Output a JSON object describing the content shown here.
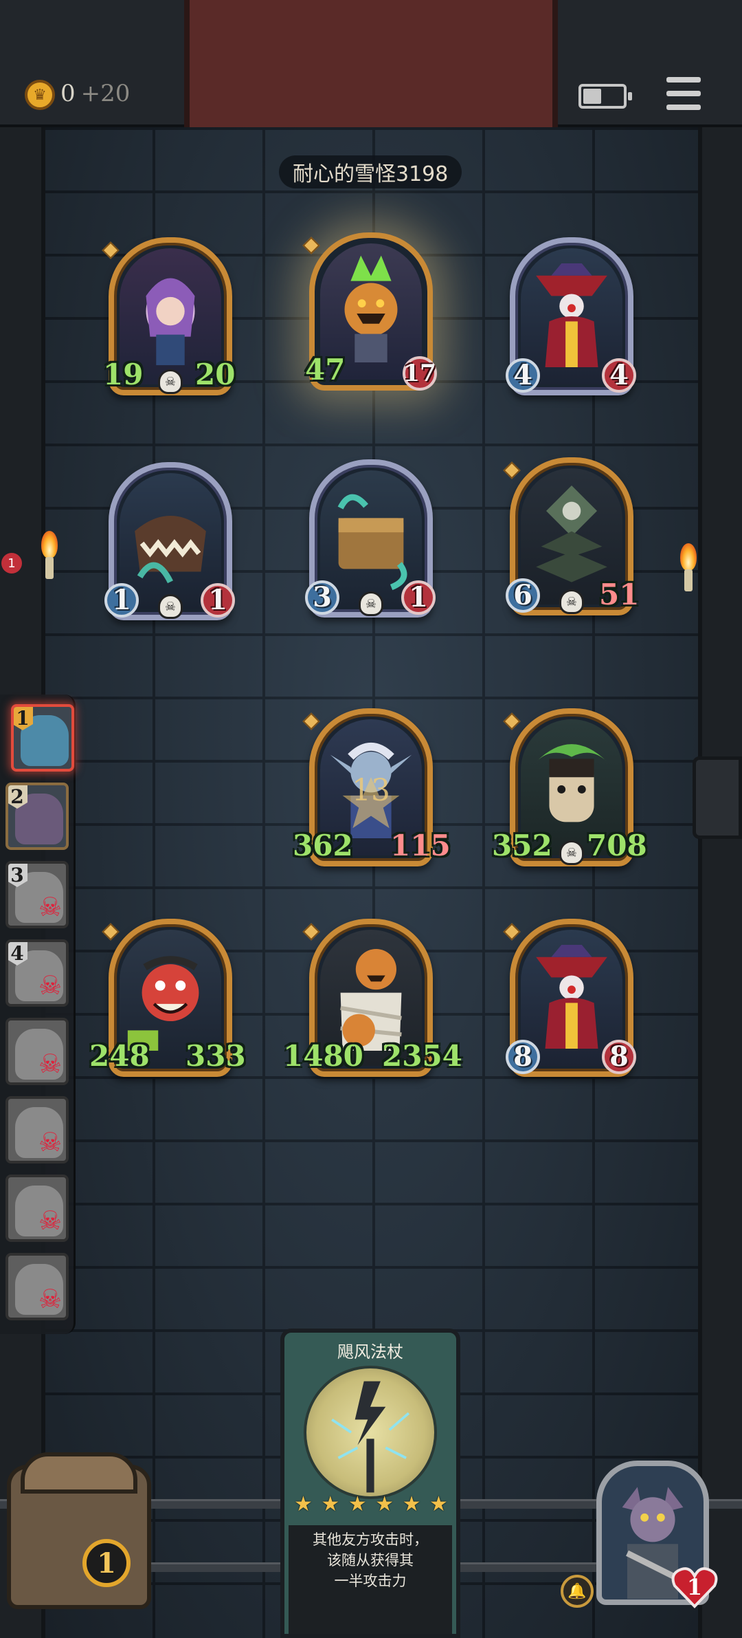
{
  "hud": {
    "gold": "0",
    "gold_income": "+20",
    "coin_icon": "crown-coin-icon",
    "battery_icon": "battery-icon",
    "menu_icon": "menu-icon"
  },
  "opponent_name": "耐心的雪怪3198",
  "board": [
    {
      "name": "witch-mage",
      "atk": "19",
      "hp": "20",
      "style": "plain",
      "tier_frame": "gold",
      "skull": true
    },
    {
      "name": "pumpkin-knight",
      "atk": "47",
      "hp": "17",
      "style": "atk-plain-hp-badge",
      "tier_frame": "gold",
      "skull": false
    },
    {
      "name": "clown",
      "atk": "4",
      "hp": "4",
      "style": "badge",
      "tier_frame": "silver",
      "skull": false
    },
    {
      "name": "mimic-teeth",
      "atk": "1",
      "hp": "1",
      "style": "badge",
      "tier_frame": "silver",
      "skull": true
    },
    {
      "name": "treasure-chest-mimic",
      "atk": "3",
      "hp": "1",
      "style": "badge",
      "tier_frame": "silver",
      "skull": true
    },
    {
      "name": "skull-pagoda",
      "atk": "6",
      "hp": "51",
      "style": "badge-hpred",
      "tier_frame": "gold",
      "skull": true
    },
    {
      "name": "dark-elf",
      "atk": "362",
      "hp": "115",
      "overlay": "13",
      "style": "plain-hpred",
      "tier_frame": "gold",
      "skull": false
    },
    {
      "name": "leaf-sprite",
      "atk": "352",
      "hp": "708",
      "style": "plain",
      "tier_frame": "gold",
      "skull": true
    },
    {
      "name": "red-goblin",
      "atk": "248",
      "hp": "333",
      "style": "plain",
      "tier_frame": "gold",
      "skull": false
    },
    {
      "name": "pumpkin-mummy",
      "atk": "1480",
      "hp": "2354",
      "style": "plain",
      "tier_frame": "gold",
      "skull": false
    },
    {
      "name": "clown-2",
      "atk": "8",
      "hp": "8",
      "style": "badge",
      "tier_frame": "gold",
      "skull": false
    }
  ],
  "roster": [
    {
      "num": "1",
      "state": "active"
    },
    {
      "num": "2",
      "state": "alive"
    },
    {
      "num": "3",
      "state": "dead"
    },
    {
      "num": "4",
      "state": "dead"
    },
    {
      "num": "",
      "state": "dead"
    },
    {
      "num": "",
      "state": "dead"
    },
    {
      "num": "",
      "state": "dead"
    },
    {
      "num": "",
      "state": "dead"
    }
  ],
  "notification_count": "1",
  "item_card": {
    "title": "飓风法杖",
    "stars": 6,
    "desc_line1": "其他友方攻击时，",
    "desc_line2": "该随从获得其",
    "desc_line3": "一半攻击力"
  },
  "chest_count": "1",
  "hero_lives": "1",
  "colors": {
    "gold_frame": "#c98a36",
    "silver_frame": "#9aa0c0",
    "atk_green": "#9ee26a",
    "hp_red": "#ff8c8c",
    "card_teal": "#355a55"
  }
}
